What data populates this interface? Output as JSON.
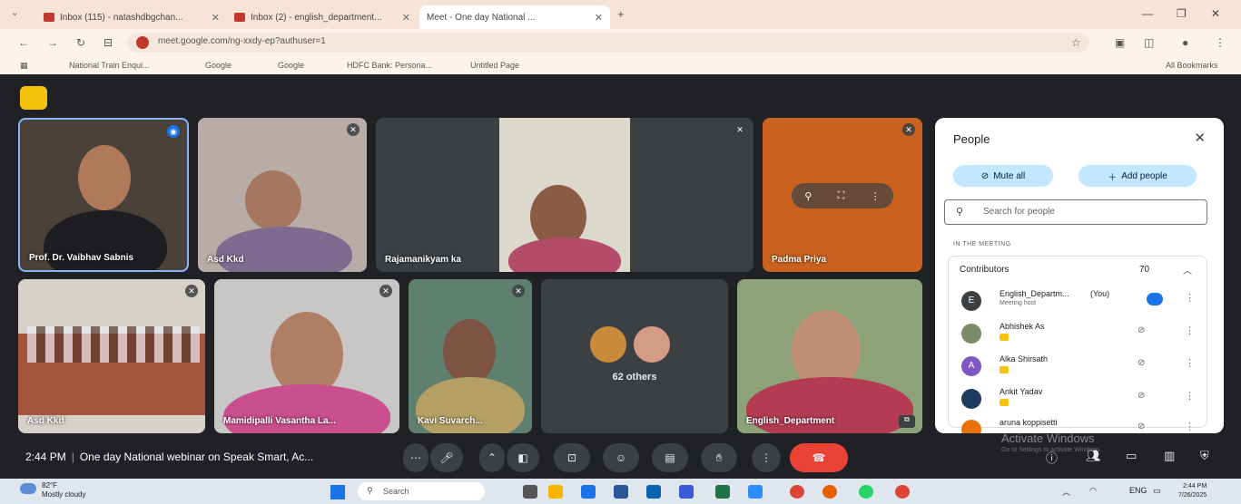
{
  "browser": {
    "tabs": [
      {
        "label": "Inbox (115) - natashdbgchan...",
        "active": false
      },
      {
        "label": "Inbox (2) - english_department...",
        "active": false
      },
      {
        "label": "Meet - One day National ...",
        "active": true
      }
    ],
    "new_tab_label": "+",
    "url": "meet.google.com/ng-xxdy-ep?authuser=1",
    "bookmarks": [
      {
        "label": "National Train Enqui..."
      },
      {
        "label": "Google"
      },
      {
        "label": "Google"
      },
      {
        "label": "HDFC Bank: Persona..."
      },
      {
        "label": "Untitled Page"
      }
    ],
    "all_bookmarks_label": "All Bookmarks"
  },
  "meeting": {
    "participants": [
      {
        "name": "Prof. Dr. Vaibhav Sabnis",
        "speaking": true
      },
      {
        "name": "Asd Kkd"
      },
      {
        "name": "Rajamanikyam ka"
      },
      {
        "name": "Padma Priya"
      },
      {
        "name": "Asd Kkd"
      },
      {
        "name": "Mamidipalli Vasantha La..."
      },
      {
        "name": "Kavi Suvarch..."
      },
      {
        "name": "English_Department"
      }
    ],
    "others_label": "62 others",
    "clock": "2:44 PM",
    "separator": "|",
    "title": "One day National webinar on Speak Smart, Ac..."
  },
  "people_panel": {
    "title": "People",
    "mute_all": "Mute all",
    "add_people": "Add people",
    "search_placeholder": "Search for people",
    "section": "IN THE MEETING",
    "group": {
      "label": "Contributors",
      "count": "70"
    },
    "rows": [
      {
        "name": "English_Departm...",
        "you": "(You)",
        "sub": "Meeting host",
        "initial": "E",
        "color": "#3c4043"
      },
      {
        "name": "Abhishek As",
        "initial": "",
        "color": "#7a8a6a"
      },
      {
        "name": "Alka Shirsath",
        "initial": "A",
        "color": "#7e57c2"
      },
      {
        "name": "Ankit Yadav",
        "initial": "",
        "color": "#1e3a5f"
      },
      {
        "name": "aruna koppisetti",
        "initial": "",
        "color": "#e8710a"
      }
    ]
  },
  "watermark": {
    "title": "Activate Windows",
    "subtitle": "Go to Settings to activate Windows."
  },
  "taskbar": {
    "temp": "82°F",
    "weather": "Mostly cloudy",
    "search": "Search",
    "time": "2:44 PM",
    "date": "7/26/2025",
    "lang": "ENG"
  }
}
